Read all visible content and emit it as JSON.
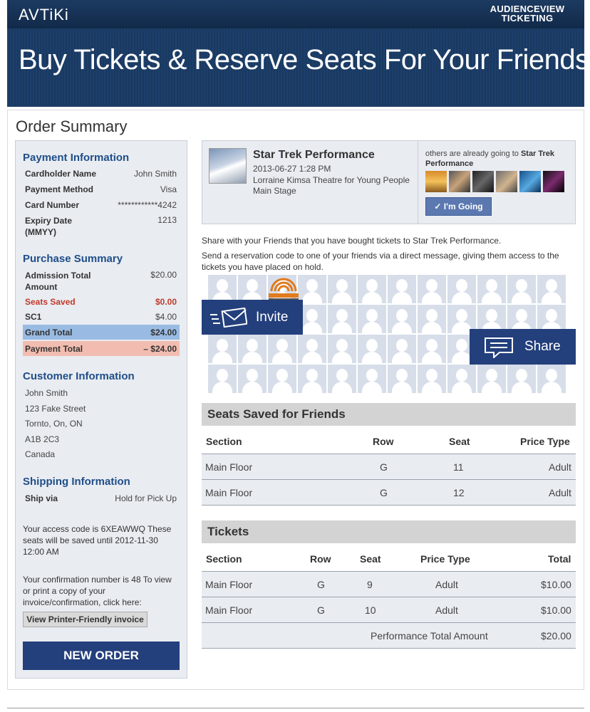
{
  "header": {
    "logo": "AVTiKi",
    "brand_line1": "AUDIENCEVIEW",
    "brand_line2": "TICKETING",
    "banner_title": "Buy Tickets & Reserve Seats For Your Friends"
  },
  "page_title": "Order Summary",
  "payment": {
    "heading": "Payment Information",
    "rows": [
      {
        "label": "Cardholder Name",
        "value": "John Smith"
      },
      {
        "label": "Payment Method",
        "value": "Visa"
      },
      {
        "label": "Card Number",
        "value": "************4242"
      },
      {
        "label": "Expiry Date (MMYY)",
        "value": "1213"
      }
    ]
  },
  "purchase": {
    "heading": "Purchase Summary",
    "admission_label": "Admission Total Amount",
    "admission_value": "$20.00",
    "seats_saved_label": "Seats Saved",
    "seats_saved_value": "$0.00",
    "sc1_label": "SC1",
    "sc1_value": "$4.00",
    "grand_total_label": "Grand Total",
    "grand_total_value": "$24.00",
    "payment_total_label": "Payment Total",
    "payment_total_value": "– $24.00"
  },
  "customer": {
    "heading": "Customer Information",
    "lines": [
      "John Smith",
      "123 Fake Street",
      "Tornto, On, ON",
      "A1B 2C3",
      "Canada"
    ]
  },
  "shipping": {
    "heading": "Shipping Information",
    "label": "Ship via",
    "value": "Hold for Pick Up"
  },
  "access_note": "Your access code is 6XEAWWQ These seats will be saved until 2012-11-30 12:00 AM",
  "confirmation_note": "Your confirmation number is 48 To view or print a copy of your invoice/confirmation, click here:",
  "print_button": "View Printer-Friendly invoice",
  "new_order_button": "NEW ORDER",
  "event": {
    "title": "Star Trek Performance",
    "datetime": "2013-06-27 1:28 PM",
    "venue": "Lorraine Kimsa Theatre for Young People Main Stage",
    "others_prefix": "others are already going to",
    "others_event": "Star Trek Performance",
    "going_button": "✓ I'm Going"
  },
  "share": {
    "share_text": "Share with your Friends that you have bought tickets to Star Trek Performance.",
    "send_text": "Send a reservation code to one of your friends via a direct message, giving them access to the tickets you have placed on hold.",
    "invite_label": "Invite",
    "share_label": "Share"
  },
  "seats_saved": {
    "title": "Seats Saved for Friends",
    "headers": [
      "Section",
      "Row",
      "Seat",
      "Price Type"
    ],
    "rows": [
      [
        "Main Floor",
        "G",
        "11",
        "Adult"
      ],
      [
        "Main Floor",
        "G",
        "12",
        "Adult"
      ]
    ]
  },
  "tickets": {
    "title": "Tickets",
    "headers": [
      "Section",
      "Row",
      "Seat",
      "Price Type",
      "Total"
    ],
    "rows": [
      [
        "Main Floor",
        "G",
        "9",
        "Adult",
        "$10.00"
      ],
      [
        "Main Floor",
        "G",
        "10",
        "Adult",
        "$10.00"
      ]
    ],
    "total_label": "Performance Total Amount",
    "total_value": "$20.00"
  },
  "colors": {
    "header_navy": "#1c3a61",
    "section_blue": "#1f4e89",
    "button_navy": "#233f7c",
    "seats_saved_red": "#c0392b",
    "grand_total_bg": "#99bbe3",
    "payment_total_bg": "#f2bdb0"
  }
}
